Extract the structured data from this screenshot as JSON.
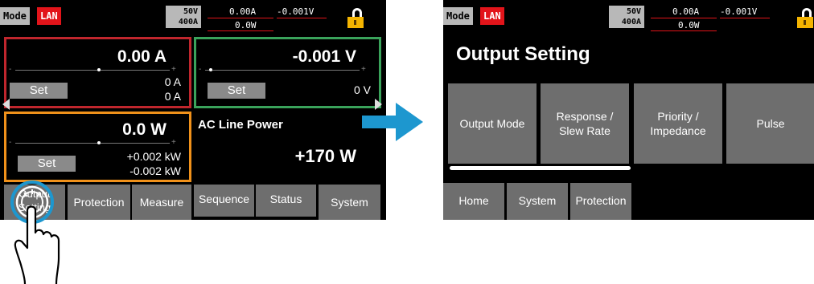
{
  "status_bar": {
    "mode_label": "Mode",
    "lan_label": "LAN",
    "voltage_range": "50V",
    "current_range": "400A",
    "current_reading": "0.00A",
    "voltage_reading": "-0.001V",
    "power_reading": "0.0W"
  },
  "left_screen": {
    "current_panel": {
      "setting": "0.00 A",
      "set_label": "Set",
      "limit_top": "0 A",
      "limit_bottom": "0 A"
    },
    "voltage_panel": {
      "setting": "-0.001 V",
      "set_label": "Set",
      "value": "0 V"
    },
    "power_panel": {
      "setting": "0.0 W",
      "set_label": "Set",
      "plus_limit": "+0.002 kW",
      "minus_limit": "-0.002 kW"
    },
    "ac_line": {
      "title": "AC Line Power",
      "value": "+170 W"
    },
    "tabs": {
      "output_setting_line1": "Output",
      "output_setting_line2": "Setting",
      "protection": "Protection",
      "measure": "Measure",
      "sequence": "Sequence",
      "status": "Status",
      "system": "System"
    },
    "scale_minus": "-",
    "scale_plus": "+"
  },
  "right_screen": {
    "title": "Output Setting",
    "buttons": [
      "Output Mode",
      "Response /\nSlew Rate",
      "Priority /\nImpedance",
      "Pulse"
    ],
    "bottom_tabs": [
      "Home",
      "System",
      "Protection"
    ]
  },
  "colors": {
    "current_border": "#c0262d",
    "voltage_border": "#3aa35b",
    "power_border": "#f0911a",
    "lan_red": "#e2141a",
    "arrow": "#1d97cf",
    "lock_gold": "#f4b400"
  }
}
